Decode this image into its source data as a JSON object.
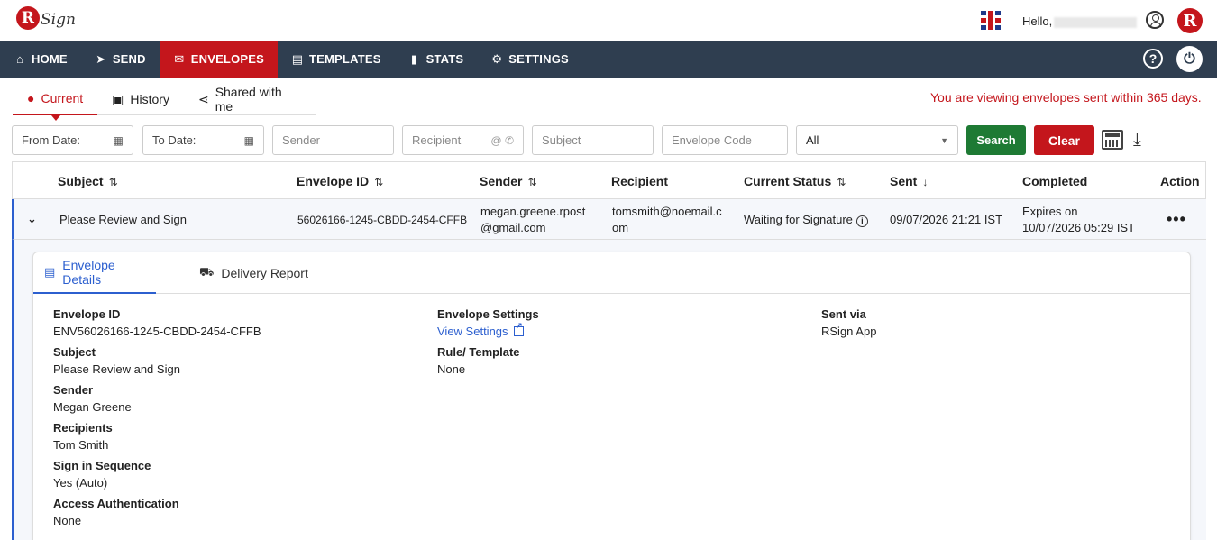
{
  "header": {
    "logo_letter": "R",
    "logo_text": "Sign",
    "hello": "Hello,",
    "brand_letter": "R"
  },
  "nav": {
    "items": [
      {
        "label": "HOME",
        "icon": "home-icon"
      },
      {
        "label": "SEND",
        "icon": "send-icon"
      },
      {
        "label": "ENVELOPES",
        "icon": "envelope-icon",
        "active": true
      },
      {
        "label": "TEMPLATES",
        "icon": "document-icon"
      },
      {
        "label": "STATS",
        "icon": "bar-chart-icon"
      },
      {
        "label": "SETTINGS",
        "icon": "gear-icon"
      }
    ],
    "help": "?",
    "accent": "#c4161c",
    "background": "#2f3e50"
  },
  "subtabs": [
    {
      "label": "Current",
      "icon": "location-pin-icon",
      "active": true
    },
    {
      "label": "History",
      "icon": "history-icon"
    },
    {
      "label": "Shared with me",
      "icon": "share-icon"
    }
  ],
  "notice": "You are viewing envelopes sent within 365 days.",
  "filters": {
    "from_date": "From Date:",
    "to_date": "To Date:",
    "sender": "Sender",
    "recipient": "Recipient",
    "subject": "Subject",
    "envelope_code": "Envelope Code",
    "status_selected": "All",
    "search_label": "Search",
    "clear_label": "Clear"
  },
  "table": {
    "columns": [
      "Subject",
      "Envelope ID",
      "Sender",
      "Recipient",
      "Current Status",
      "Sent",
      "Completed",
      "Action"
    ],
    "rows": [
      {
        "subject": "Please Review and Sign",
        "envelope_id": "56026166-1245-CBDD-2454-CFFB",
        "sender_line1": "megan.greene.rpost",
        "sender_line2": "@gmail.com",
        "recipient_line1": "tomsmith@noemail.c",
        "recipient_line2": "om",
        "status": "Waiting for Signature",
        "sent": "09/07/2026 21:21 IST",
        "completed_line1": "Expires on",
        "completed_line2": "10/07/2026 05:29 IST"
      }
    ]
  },
  "details": {
    "tabs": [
      "Envelope Details",
      "Delivery Report"
    ],
    "col1": [
      {
        "label": "Envelope ID",
        "value": "ENV56026166-1245-CBDD-2454-CFFB"
      },
      {
        "label": "Subject",
        "value": "Please Review and Sign"
      },
      {
        "label": "Sender",
        "value": "Megan Greene"
      },
      {
        "label": "Recipients",
        "value": "Tom Smith"
      },
      {
        "label": "Sign in Sequence",
        "value": "Yes (Auto)"
      },
      {
        "label": "Access Authentication",
        "value": "None"
      }
    ],
    "col2": [
      {
        "label": "Envelope Settings",
        "value": "View Settings"
      },
      {
        "label": "Rule/ Template",
        "value": "None"
      }
    ],
    "col3": [
      {
        "label": "Sent via",
        "value": "RSign App"
      }
    ]
  }
}
